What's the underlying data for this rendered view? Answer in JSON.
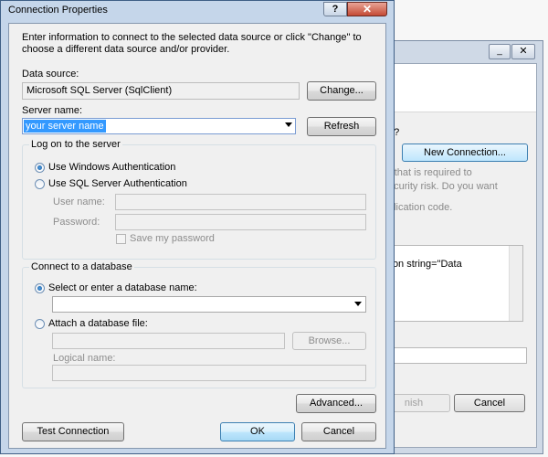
{
  "background_window": {
    "minimize_glyph": "_",
    "close_glyph": "✕",
    "question_fragment": "e?",
    "new_connection_label": "New Connection...",
    "text_lines": [
      ") that is required to",
      "ecurity risk. Do you want",
      "plication code."
    ],
    "connection_string_fragment": "sion string=\"Data",
    "finish_label": "nish",
    "cancel_label": "Cancel"
  },
  "dialog": {
    "title": "Connection Properties",
    "help_glyph": "?",
    "close_glyph": "✕",
    "intro": "Enter information to connect to the selected data source or click \"Change\" to choose a different data source and/or provider.",
    "data_source": {
      "label": "Data source:",
      "value": "Microsoft SQL Server (SqlClient)",
      "change_label": "Change..."
    },
    "server_name": {
      "label": "Server name:",
      "value": "your server name",
      "refresh_label": "Refresh"
    },
    "logon_group": {
      "title": "Log on to the server",
      "windows_auth_label": "Use Windows Authentication",
      "sql_auth_label": "Use SQL Server Authentication",
      "selected": "windows",
      "user_name_label": "User name:",
      "password_label": "Password:",
      "save_password_label": "Save my password",
      "save_password_checked": false
    },
    "database_group": {
      "title": "Connect to a database",
      "select_db_label": "Select or enter a database name:",
      "attach_label": "Attach a database file:",
      "selected": "select",
      "browse_label": "Browse...",
      "logical_name_label": "Logical name:"
    },
    "advanced_label": "Advanced...",
    "test_connection_label": "Test Connection",
    "ok_label": "OK",
    "cancel_label": "Cancel"
  }
}
